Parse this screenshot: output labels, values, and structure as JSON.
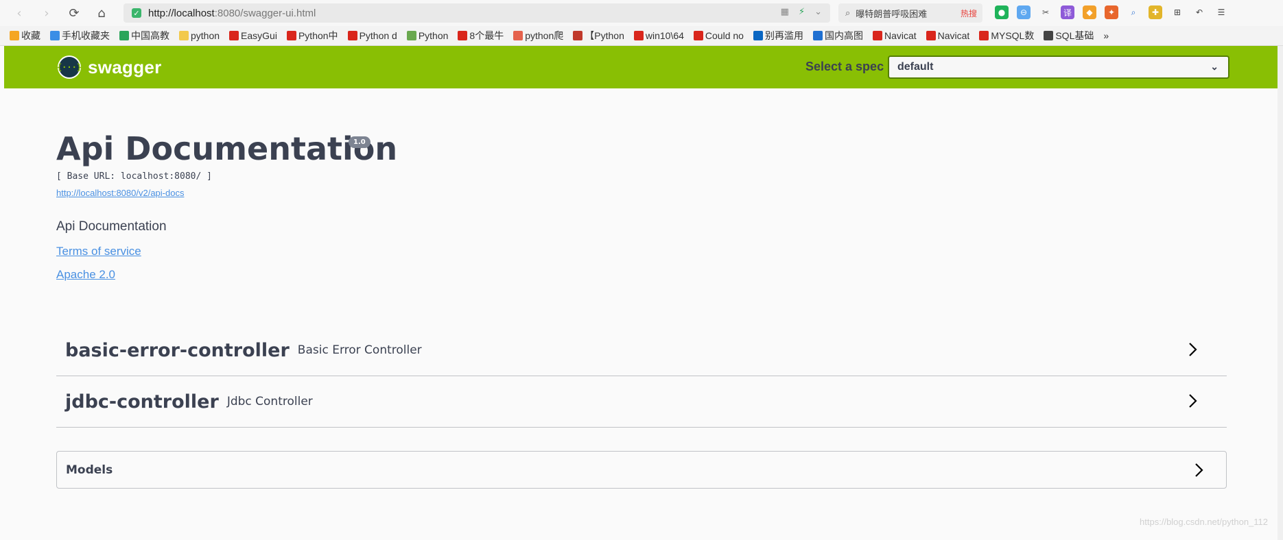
{
  "browser": {
    "url_host": "http://localhost",
    "url_port_path": ":8080/swagger-ui.html",
    "search_text": "曝特朗普呼吸困难",
    "search_hot": "热搜",
    "bookmarks": [
      {
        "label": "收藏",
        "icon": "star-icon",
        "color": "#f5a623"
      },
      {
        "label": "手机收藏夹",
        "icon": "phone-icon",
        "color": "#3a8ee6"
      },
      {
        "label": "中国高教",
        "icon": "globe-icon",
        "color": "#2aa55a"
      },
      {
        "label": "python",
        "icon": "folder-icon",
        "color": "#f2c94c"
      },
      {
        "label": "EasyGui",
        "icon": "csdn-icon",
        "color": "#d9261c"
      },
      {
        "label": "Python中",
        "icon": "csdn-icon",
        "color": "#d9261c"
      },
      {
        "label": "Python d",
        "icon": "csdn-icon",
        "color": "#d9261c"
      },
      {
        "label": "Python",
        "icon": "python-icon",
        "color": "#6aa84f"
      },
      {
        "label": "8个最牛",
        "icon": "csdn-icon",
        "color": "#d9261c"
      },
      {
        "label": "python爬",
        "icon": "jianshu-icon",
        "color": "#e5624d"
      },
      {
        "label": "【Python",
        "icon": "blog-icon",
        "color": "#c0392b"
      },
      {
        "label": "win10\\64",
        "icon": "csdn-icon",
        "color": "#d9261c"
      },
      {
        "label": "Could no",
        "icon": "csdn-icon",
        "color": "#d9261c"
      },
      {
        "label": "别再滥用",
        "icon": "zhihu-icon",
        "color": "#0a66c2"
      },
      {
        "label": "国内高图",
        "icon": "k-icon",
        "color": "#1f6fd1"
      },
      {
        "label": "Navicat",
        "icon": "csdn-icon",
        "color": "#d9261c"
      },
      {
        "label": "Navicat",
        "icon": "csdn-icon",
        "color": "#d9261c"
      },
      {
        "label": "MYSQL数",
        "icon": "csdn-icon",
        "color": "#d9261c"
      },
      {
        "label": "SQL基础",
        "icon": "sql-icon",
        "color": "#444444"
      },
      {
        "label": "»",
        "icon": "more-icon",
        "color": "#666666"
      }
    ]
  },
  "swagger": {
    "logo_text": "swagger",
    "spec_label": "Select a spec",
    "spec_value": "default",
    "title": "Api Documentation",
    "version": "1.0",
    "base_url": "[ Base URL: localhost:8080/ ]",
    "api_docs_url": "http://localhost:8080/v2/api-docs",
    "description": "Api Documentation",
    "terms": "Terms of service",
    "license": "Apache 2.0",
    "tags": [
      {
        "name": "basic-error-controller",
        "desc": "Basic Error Controller"
      },
      {
        "name": "jdbc-controller",
        "desc": "Jdbc Controller"
      }
    ],
    "models_label": "Models"
  },
  "watermark": "https://blog.csdn.net/python_112"
}
